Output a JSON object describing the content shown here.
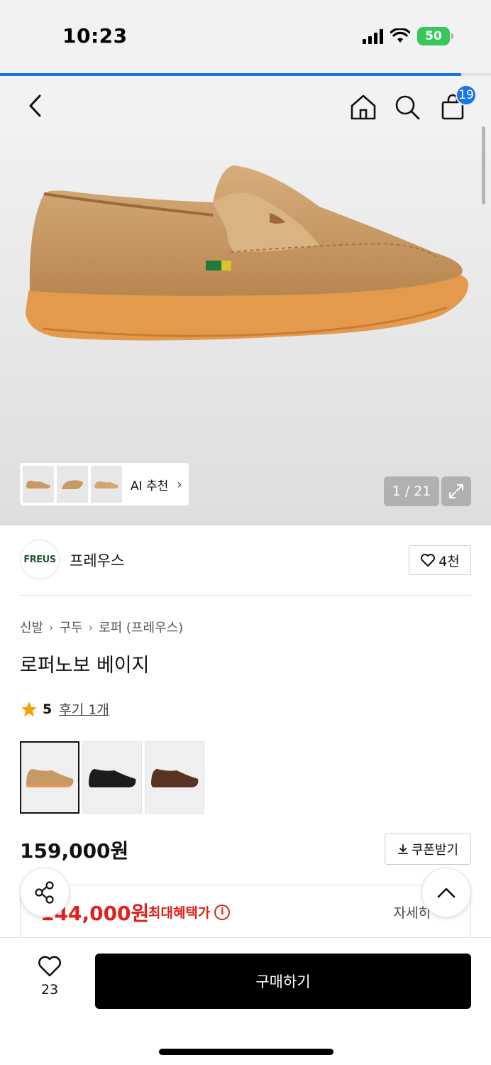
{
  "status_bar": {
    "time": "10:23",
    "battery": "50"
  },
  "page_progress": 0.94,
  "header": {
    "cart_count": "19"
  },
  "gallery": {
    "ai_label": "AI 추천",
    "page_counter": "1 / 21"
  },
  "brand": {
    "logo_text": "FREUS",
    "name": "프레우스",
    "likes": "4천"
  },
  "breadcrumb": [
    "신발",
    "구두",
    "로퍼 (프레우스)"
  ],
  "product": {
    "title": "로퍼노보 베이지"
  },
  "rating": {
    "score": "5",
    "reviews": "후기 1개"
  },
  "color_options": [
    {
      "name": "beige",
      "color": "#c89a63"
    },
    {
      "name": "black",
      "color": "#1c1c1c"
    },
    {
      "name": "brown",
      "color": "#5a3222"
    }
  ],
  "price": {
    "original": "159,000원",
    "coupon_label": "쿠폰받기"
  },
  "benefit": {
    "price": "144,000원",
    "label": "최대혜택가",
    "detail": "자세히"
  },
  "bottom_bar": {
    "wish_count": "23",
    "buy_label": "구매하기"
  },
  "colors": {
    "accent": "#1a73e8",
    "sale_red": "#e0211c",
    "shoe_tan": "#c89a63",
    "sole": "#e39a4d"
  }
}
